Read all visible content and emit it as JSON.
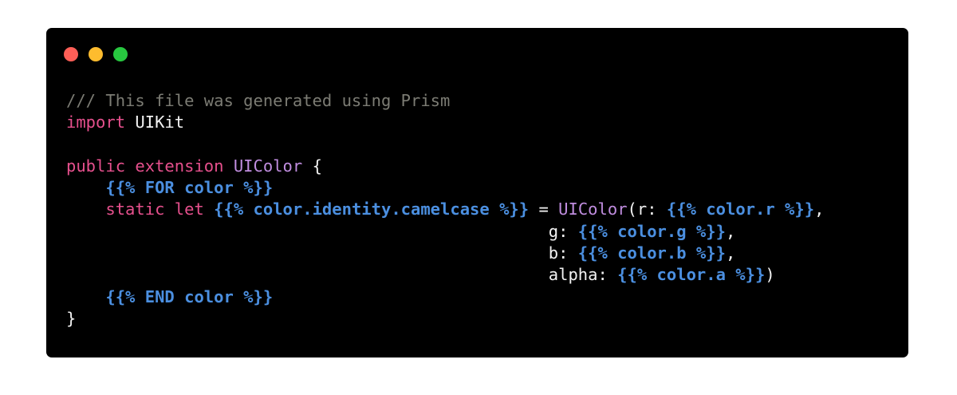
{
  "window": {
    "traffic_lights": [
      {
        "name": "close",
        "color": "#fe5f57"
      },
      {
        "name": "minimize",
        "color": "#febc2e"
      },
      {
        "name": "maximize",
        "color": "#28c840"
      }
    ]
  },
  "code": {
    "lines": [
      {
        "indent": "",
        "tokens": [
          {
            "t": "comment",
            "v": "/// This file was generated using Prism"
          }
        ]
      },
      {
        "indent": "",
        "tokens": [
          {
            "t": "keyword",
            "v": "import"
          },
          {
            "t": "plain",
            "v": " UIKit"
          }
        ]
      },
      {
        "indent": "",
        "tokens": []
      },
      {
        "indent": "",
        "tokens": [
          {
            "t": "keyword",
            "v": "public"
          },
          {
            "t": "plain",
            "v": " "
          },
          {
            "t": "keyword",
            "v": "extension"
          },
          {
            "t": "plain",
            "v": " "
          },
          {
            "t": "type",
            "v": "UIColor"
          },
          {
            "t": "plain",
            "v": " {"
          }
        ]
      },
      {
        "indent": "    ",
        "tokens": [
          {
            "t": "template",
            "v": "{{% FOR color %}}"
          }
        ]
      },
      {
        "indent": "    ",
        "tokens": [
          {
            "t": "keyword",
            "v": "static"
          },
          {
            "t": "plain",
            "v": " "
          },
          {
            "t": "keyword",
            "v": "let"
          },
          {
            "t": "plain",
            "v": " "
          },
          {
            "t": "template",
            "v": "{{% color.identity.camelcase %}}"
          },
          {
            "t": "plain",
            "v": " = "
          },
          {
            "t": "type",
            "v": "UIColor"
          },
          {
            "t": "plain",
            "v": "(r: "
          },
          {
            "t": "template",
            "v": "{{% color.r %}}"
          },
          {
            "t": "plain",
            "v": ","
          }
        ]
      },
      {
        "indent": "                                                 ",
        "tokens": [
          {
            "t": "plain",
            "v": "g: "
          },
          {
            "t": "template",
            "v": "{{% color.g %}}"
          },
          {
            "t": "plain",
            "v": ","
          }
        ]
      },
      {
        "indent": "                                                 ",
        "tokens": [
          {
            "t": "plain",
            "v": "b: "
          },
          {
            "t": "template",
            "v": "{{% color.b %}}"
          },
          {
            "t": "plain",
            "v": ","
          }
        ]
      },
      {
        "indent": "                                                 ",
        "tokens": [
          {
            "t": "plain",
            "v": "alpha: "
          },
          {
            "t": "template",
            "v": "{{% color.a %}}"
          },
          {
            "t": "plain",
            "v": ")"
          }
        ]
      },
      {
        "indent": "    ",
        "tokens": [
          {
            "t": "template",
            "v": "{{% END color %}}"
          }
        ]
      },
      {
        "indent": "",
        "tokens": [
          {
            "t": "plain",
            "v": "}"
          }
        ]
      }
    ]
  }
}
